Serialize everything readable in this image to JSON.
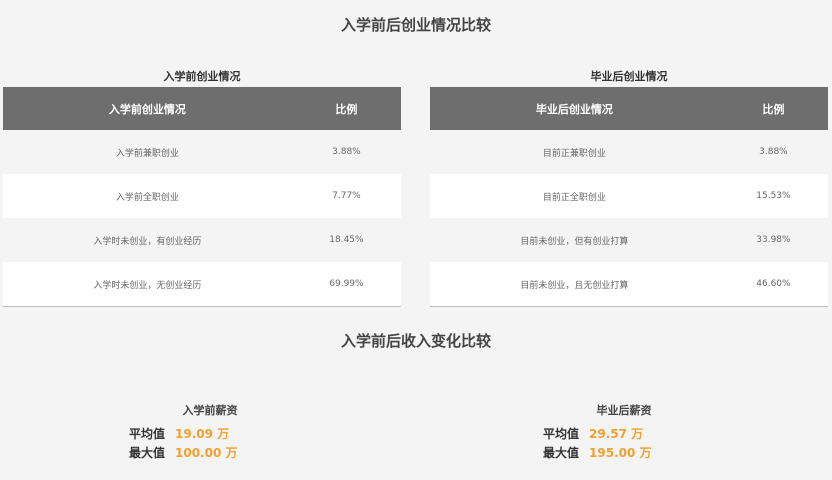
{
  "header": {
    "title": "入学前后创业情况比较"
  },
  "before_table": {
    "caption": "入学前创业情况",
    "col_headers": [
      "入学前创业情况",
      "比例"
    ],
    "rows": [
      {
        "label": "入学前兼职创业",
        "value": "3.88%"
      },
      {
        "label": "入学前全职创业",
        "value": "7.77%"
      },
      {
        "label": "入学时未创业，有创业经历",
        "value": "18.45%"
      },
      {
        "label": "入学时未创业，无创业经历",
        "value": "69.99%"
      }
    ]
  },
  "after_table": {
    "caption": "毕业后创业情况",
    "col_headers": [
      "毕业后创业情况",
      "比例"
    ],
    "rows": [
      {
        "label": "目前正兼职创业",
        "value": "3.88%"
      },
      {
        "label": "目前正全职创业",
        "value": "15.53%"
      },
      {
        "label": "目前未创业，但有创业打算",
        "value": "33.98%"
      },
      {
        "label": "目前未创业，且无创业打算",
        "value": "46.60%"
      }
    ]
  },
  "income": {
    "title": "入学前后收入变化比较",
    "before": {
      "title": "入学前薪资",
      "avg_label": "平均值",
      "avg_value": "19.09 万",
      "max_label": "最大值",
      "max_value": "100.00 万"
    },
    "after": {
      "title": "毕业后薪资",
      "avg_label": "平均值",
      "avg_value": "29.57 万",
      "max_label": "最大值",
      "max_value": "195.00 万"
    }
  },
  "colors": {
    "header_bg": "#6e6e6e",
    "value_accent": "#f0a030"
  }
}
